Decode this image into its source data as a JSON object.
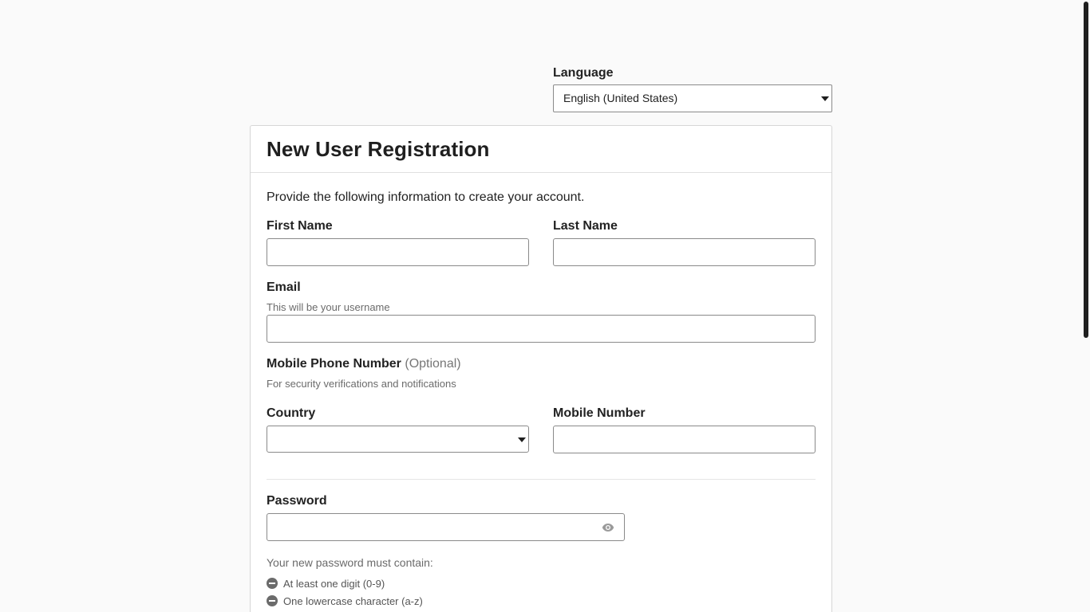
{
  "language": {
    "label": "Language",
    "selected": "English (United States)"
  },
  "card": {
    "title": "New User Registration",
    "intro": "Provide the following information to create your account."
  },
  "form": {
    "first_name_label": "First Name",
    "last_name_label": "Last Name",
    "email_label": "Email",
    "email_hint": "This will be your username",
    "mobile_section_label": "Mobile Phone Number",
    "mobile_optional": "(Optional)",
    "mobile_hint": "For security verifications and notifications",
    "country_label": "Country",
    "country_selected": "",
    "mobile_number_label": "Mobile Number",
    "password_label": "Password"
  },
  "password_requirements": {
    "title": "Your new password must contain:",
    "items": [
      "At least one digit (0-9)",
      "One lowercase character (a-z)"
    ]
  },
  "icons": {
    "eye": "eye-icon",
    "requirement": "minus-circle-icon",
    "dropdown": "caret-down-icon"
  }
}
